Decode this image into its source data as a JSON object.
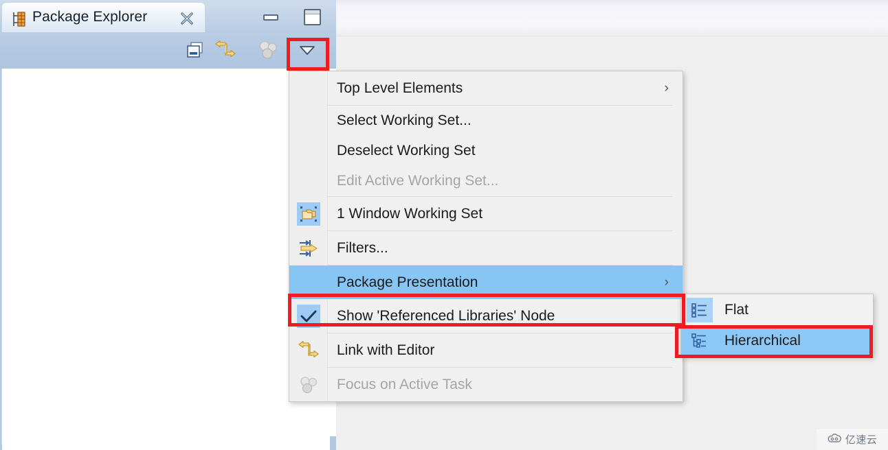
{
  "view": {
    "tab_title": "Package Explorer",
    "tab_icon": "package-explorer-icon",
    "close_icon": "close-icon",
    "minimize_icon": "minimize-icon",
    "maximize_icon": "maximize-icon",
    "toolbar": [
      {
        "name": "collapse-all-icon",
        "label": "Collapse All",
        "enabled": true
      },
      {
        "name": "link-with-editor-icon",
        "label": "Link with Editor",
        "enabled": true
      },
      {
        "name": "focus-on-active-task-icon",
        "label": "Focus on Active Task",
        "enabled": false
      },
      {
        "name": "view-menu-icon",
        "label": "View Menu",
        "enabled": true
      }
    ]
  },
  "menu": {
    "items": [
      {
        "label": "Top Level Elements",
        "icon": null,
        "submenu": true,
        "enabled": true,
        "checked": false,
        "highlighted": false,
        "separator_after": true
      },
      {
        "label": "Select Working Set...",
        "icon": null,
        "submenu": false,
        "enabled": true,
        "checked": false,
        "highlighted": false,
        "separator_after": false
      },
      {
        "label": "Deselect Working Set",
        "icon": null,
        "submenu": false,
        "enabled": true,
        "checked": false,
        "highlighted": false,
        "separator_after": false
      },
      {
        "label": "Edit Active Working Set...",
        "icon": null,
        "submenu": false,
        "enabled": false,
        "checked": false,
        "highlighted": false,
        "separator_after": true
      },
      {
        "label": "1 Window Working Set",
        "icon": "working-set-icon",
        "submenu": false,
        "enabled": true,
        "checked": true,
        "highlighted": false,
        "separator_after": true
      },
      {
        "label": "Filters...",
        "icon": "filters-icon",
        "submenu": false,
        "enabled": true,
        "checked": false,
        "highlighted": false,
        "separator_after": true
      },
      {
        "label": "Package Presentation",
        "icon": null,
        "submenu": true,
        "enabled": true,
        "checked": false,
        "highlighted": true,
        "separator_after": false
      },
      {
        "label": "Show 'Referenced Libraries' Node",
        "icon": "checkmark-icon",
        "submenu": false,
        "enabled": true,
        "checked": true,
        "highlighted": false,
        "separator_after": true
      },
      {
        "label": "Link with Editor",
        "icon": "link-with-editor-icon",
        "submenu": false,
        "enabled": true,
        "checked": false,
        "highlighted": false,
        "separator_after": true
      },
      {
        "label": "Focus on Active Task",
        "icon": "focus-on-active-task-icon",
        "submenu": false,
        "enabled": false,
        "checked": false,
        "highlighted": false,
        "separator_after": false
      }
    ]
  },
  "submenu": {
    "title": "Package Presentation",
    "items": [
      {
        "label": "Flat",
        "icon": "flat-list-icon",
        "highlighted": false
      },
      {
        "label": "Hierarchical",
        "icon": "hierarchical-tree-icon",
        "highlighted": true
      }
    ]
  },
  "annotations": [
    {
      "name": "view-menu-button-highlight",
      "target": "View Menu toolbar button"
    },
    {
      "name": "package-presentation-highlight",
      "target": "Package Presentation"
    },
    {
      "name": "hierarchical-highlight",
      "target": "Hierarchical"
    }
  ],
  "watermark": {
    "text": "亿速云",
    "icon": "cloud-icon"
  },
  "colors": {
    "menu_highlight": "#86c5f4",
    "annotation_red": "#ee1c22",
    "tab_bar": "#b7cbe3",
    "icon_gold": "#e8b33d"
  }
}
